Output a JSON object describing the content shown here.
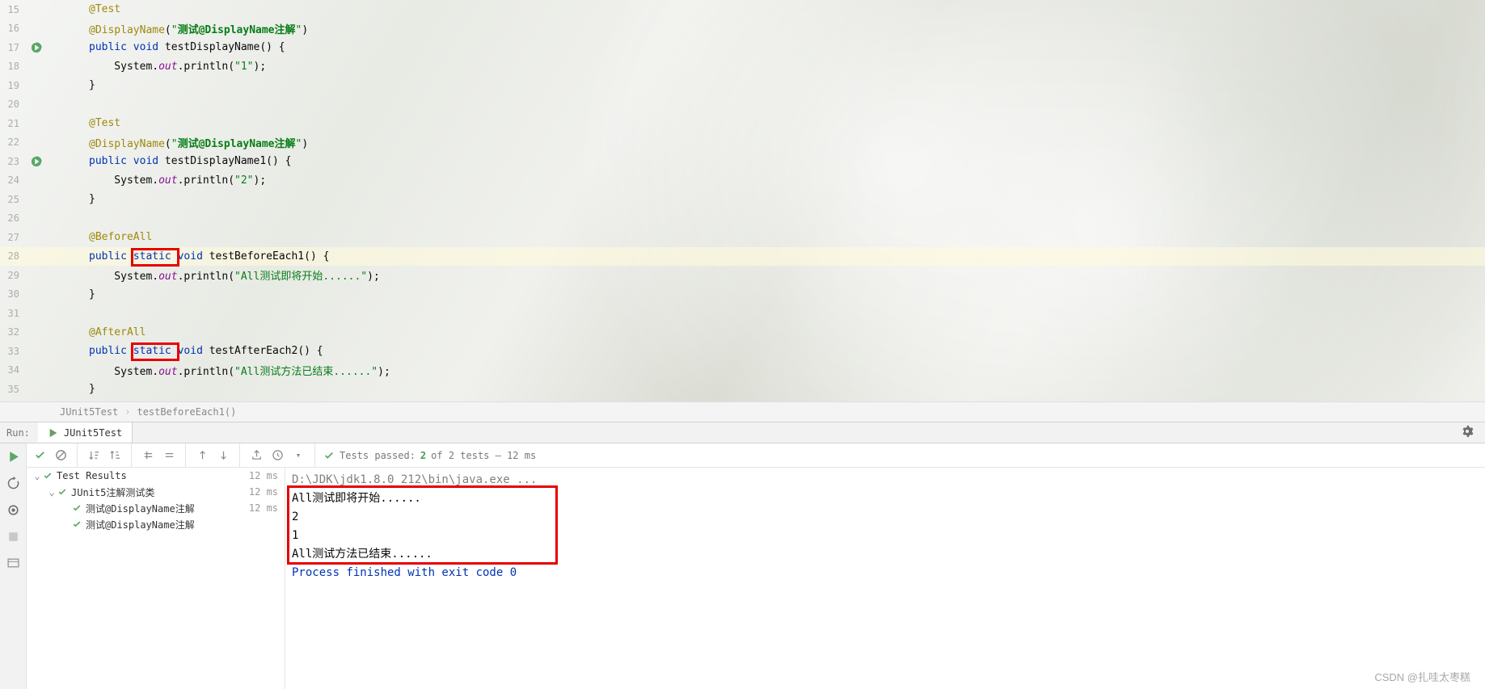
{
  "code": {
    "lines": [
      {
        "n": 15,
        "run": false,
        "html": "@Test",
        "cls": "ann"
      },
      {
        "n": 16,
        "run": false,
        "raw": [
          {
            "t": "@DisplayName",
            "c": "ann"
          },
          {
            "t": "(",
            "c": ""
          },
          {
            "t": "\"",
            "c": "str"
          },
          {
            "t": "测试@DisplayName注解",
            "c": "cn-str"
          },
          {
            "t": "\"",
            "c": "str"
          },
          {
            "t": ")",
            "c": ""
          }
        ]
      },
      {
        "n": 17,
        "run": true,
        "raw": [
          {
            "t": "public void ",
            "c": "kw"
          },
          {
            "t": "testDisplayName",
            "c": ""
          },
          {
            "t": "() {",
            "c": ""
          }
        ]
      },
      {
        "n": 18,
        "run": false,
        "raw": [
          {
            "t": "    System.",
            "c": ""
          },
          {
            "t": "out",
            "c": "static-f"
          },
          {
            "t": ".println(",
            "c": ""
          },
          {
            "t": "\"1\"",
            "c": "str"
          },
          {
            "t": ");",
            "c": ""
          }
        ]
      },
      {
        "n": 19,
        "run": false,
        "raw": [
          {
            "t": "}",
            "c": ""
          }
        ]
      },
      {
        "n": 20,
        "run": false,
        "raw": []
      },
      {
        "n": 21,
        "run": false,
        "html": "@Test",
        "cls": "ann"
      },
      {
        "n": 22,
        "run": false,
        "raw": [
          {
            "t": "@DisplayName",
            "c": "ann"
          },
          {
            "t": "(",
            "c": ""
          },
          {
            "t": "\"",
            "c": "str"
          },
          {
            "t": "测试@DisplayName注解",
            "c": "cn-str"
          },
          {
            "t": "\"",
            "c": "str"
          },
          {
            "t": ")",
            "c": ""
          }
        ]
      },
      {
        "n": 23,
        "run": true,
        "raw": [
          {
            "t": "public void ",
            "c": "kw"
          },
          {
            "t": "testDisplayName1",
            "c": ""
          },
          {
            "t": "() {",
            "c": ""
          }
        ]
      },
      {
        "n": 24,
        "run": false,
        "raw": [
          {
            "t": "    System.",
            "c": ""
          },
          {
            "t": "out",
            "c": "static-f"
          },
          {
            "t": ".println(",
            "c": ""
          },
          {
            "t": "\"2\"",
            "c": "str"
          },
          {
            "t": ");",
            "c": ""
          }
        ]
      },
      {
        "n": 25,
        "run": false,
        "raw": [
          {
            "t": "}",
            "c": ""
          }
        ]
      },
      {
        "n": 26,
        "run": false,
        "raw": []
      },
      {
        "n": 27,
        "run": false,
        "html": "@BeforeAll",
        "cls": "ann"
      },
      {
        "n": 28,
        "run": false,
        "hl": true,
        "raw": [
          {
            "t": "public ",
            "c": "kw"
          },
          {
            "t": "static ",
            "c": "kw",
            "box": true
          },
          {
            "t": "void ",
            "c": "kw"
          },
          {
            "t": "testBeforeEach1",
            "c": ""
          },
          {
            "t": "() {",
            "c": ""
          }
        ]
      },
      {
        "n": 29,
        "run": false,
        "raw": [
          {
            "t": "    System.",
            "c": ""
          },
          {
            "t": "out",
            "c": "static-f"
          },
          {
            "t": ".println(",
            "c": ""
          },
          {
            "t": "\"All测试即将开始......\"",
            "c": "str"
          },
          {
            "t": ");",
            "c": ""
          }
        ]
      },
      {
        "n": 30,
        "run": false,
        "raw": [
          {
            "t": "}",
            "c": ""
          }
        ]
      },
      {
        "n": 31,
        "run": false,
        "raw": []
      },
      {
        "n": 32,
        "run": false,
        "html": "@AfterAll",
        "cls": "ann"
      },
      {
        "n": 33,
        "run": false,
        "raw": [
          {
            "t": "public ",
            "c": "kw"
          },
          {
            "t": "static ",
            "c": "kw",
            "box": true
          },
          {
            "t": "void ",
            "c": "kw"
          },
          {
            "t": "testAfterEach2",
            "c": ""
          },
          {
            "t": "() {",
            "c": ""
          }
        ]
      },
      {
        "n": 34,
        "run": false,
        "raw": [
          {
            "t": "    System.",
            "c": ""
          },
          {
            "t": "out",
            "c": "static-f"
          },
          {
            "t": ".println(",
            "c": ""
          },
          {
            "t": "\"All测试方法已结束......\"",
            "c": "str"
          },
          {
            "t": ");",
            "c": ""
          }
        ]
      },
      {
        "n": 35,
        "run": false,
        "raw": [
          {
            "t": "}",
            "c": ""
          }
        ]
      }
    ]
  },
  "breadcrumb": {
    "class": "JUnit5Test",
    "method": "testBeforeEach1()"
  },
  "runbar": {
    "label": "Run:",
    "tab": "JUnit5Test"
  },
  "tests": {
    "summary_prefix": "Tests passed:",
    "passed": "2",
    "summary_suffix": "of 2 tests – 12 ms",
    "root": {
      "name": "Test Results",
      "time": "12 ms"
    },
    "suite": {
      "name": "JUnit5注解测试类",
      "time": "12 ms"
    },
    "items": [
      {
        "name": "测试@DisplayName注解",
        "time": "12 ms"
      },
      {
        "name": "测试@DisplayName注解",
        "time": ""
      }
    ]
  },
  "console": {
    "cmd": "D:\\JDK\\jdk1.8.0_212\\bin\\java.exe ...",
    "lines": [
      "All测试即将开始......",
      "2",
      "1",
      "All测试方法已结束......"
    ],
    "exit": "Process finished with exit code 0"
  },
  "watermark": "CSDN @扎哇太枣糕"
}
